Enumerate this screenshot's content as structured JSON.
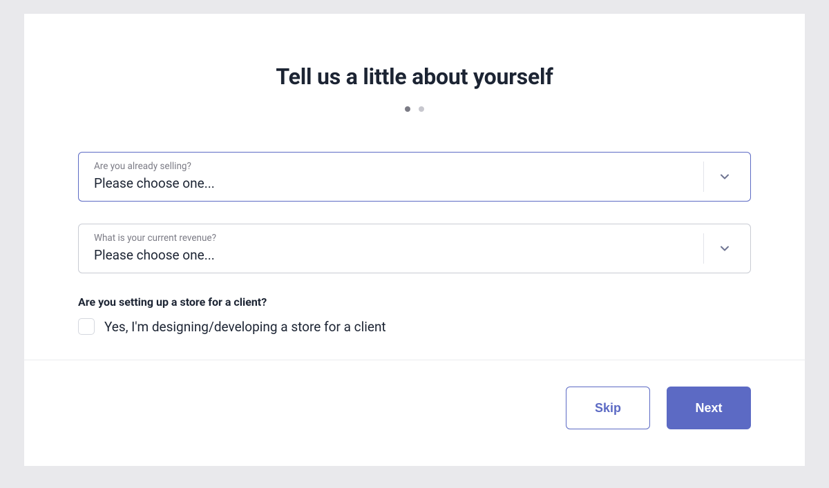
{
  "header": {
    "title": "Tell us a little about yourself",
    "step_current": 1,
    "step_total": 2
  },
  "form": {
    "dropdowns": [
      {
        "label": "Are you already selling?",
        "value": "Please choose one...",
        "focused": true
      },
      {
        "label": "What is your current revenue?",
        "value": "Please choose one...",
        "focused": false
      }
    ],
    "client_question": {
      "label": "Are you setting up a store for a client?",
      "checkbox_label": "Yes, I'm designing/developing a store for a client",
      "checked": false
    }
  },
  "footer": {
    "skip_label": "Skip",
    "next_label": "Next"
  }
}
